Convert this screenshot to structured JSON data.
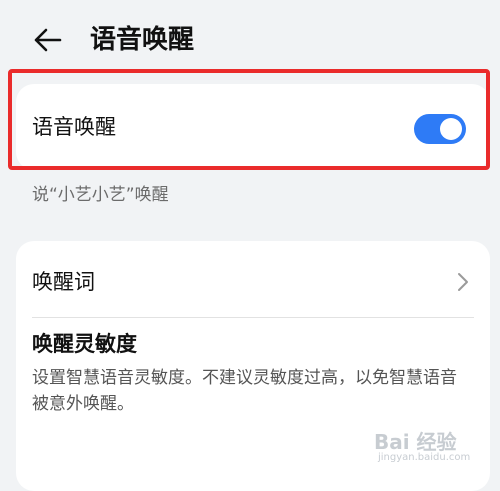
{
  "header": {
    "back_icon": "arrow-left-icon",
    "title": "语音唤醒"
  },
  "voice_wakeup": {
    "label": "语音唤醒",
    "toggle_on": true,
    "toggle_color": "#2e7bf6",
    "hint": "说“小艺小艺”唤醒"
  },
  "settings": {
    "wake_word_label": "唤醒词",
    "chevron_icon": "chevron-right-icon",
    "sensitivity_label": "唤醒灵敏度",
    "sensitivity_desc": "设置智慧语音灵敏度。不建议灵敏度过高，以免智慧语音被意外唤醒。"
  },
  "watermark": {
    "text": "Bai 经验",
    "url": "jingyan.baidu.com"
  },
  "colors": {
    "background": "#f1f3f5",
    "card": "#ffffff",
    "highlight": "#ea2b2b"
  }
}
